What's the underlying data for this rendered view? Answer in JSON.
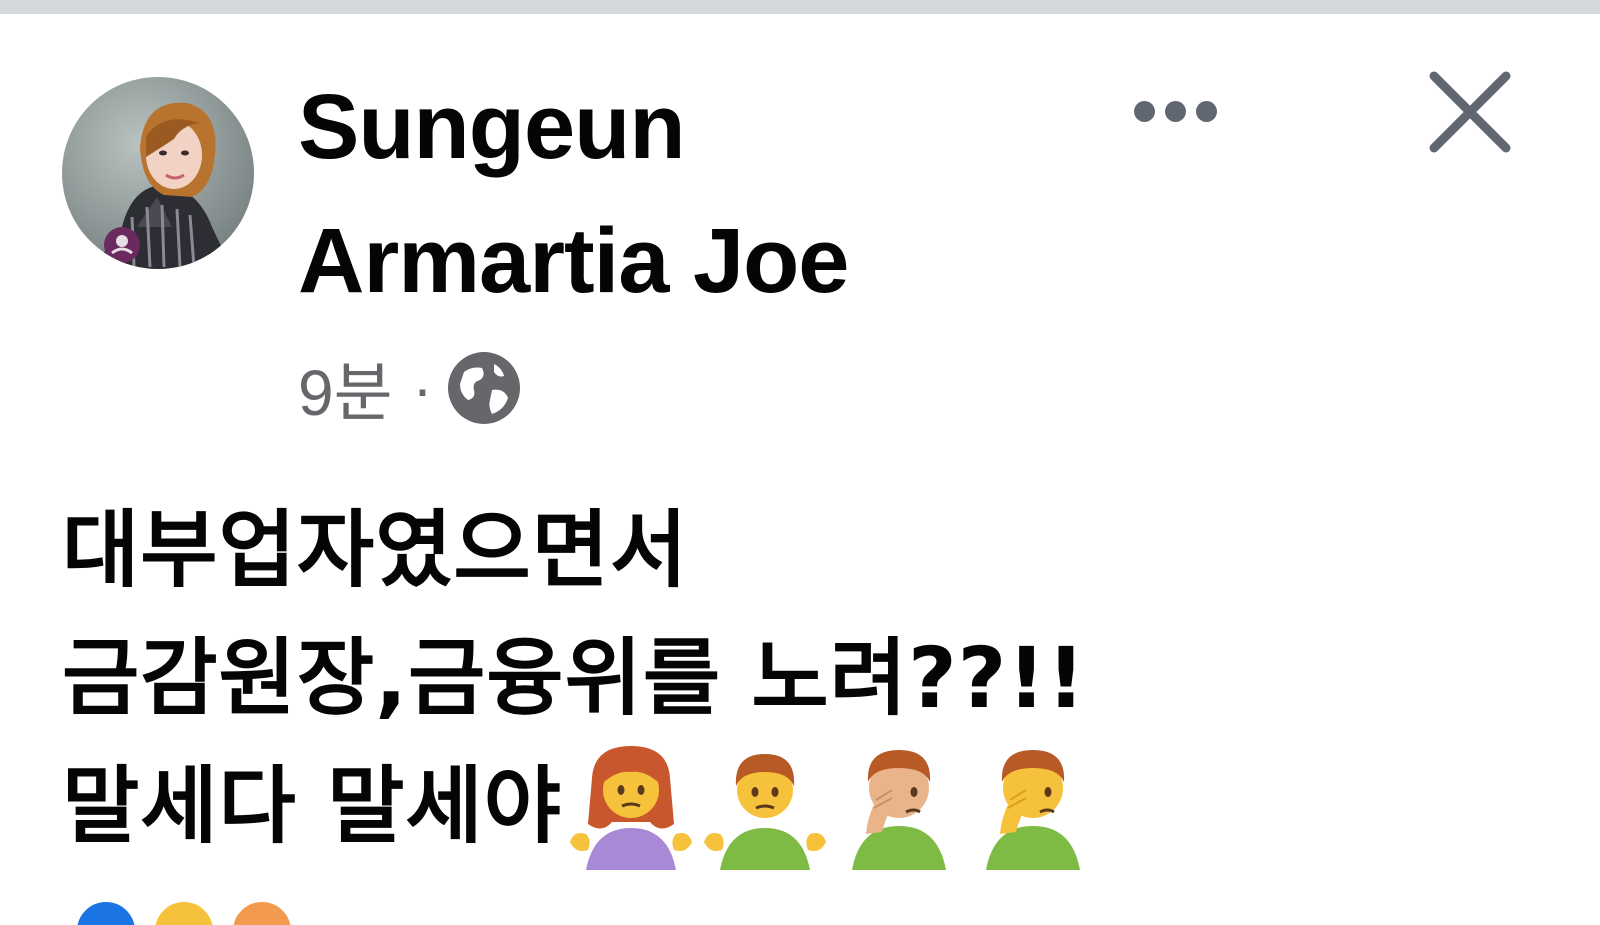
{
  "post": {
    "author_name": "Sungeun Armartia Joe",
    "time": "9분",
    "separator": "·",
    "visibility_icon": "globe-icon",
    "body_lines": [
      "대부업자였으면서",
      "금감원장,금융위를 노려??!!",
      "말세다 말세야"
    ],
    "emojis": [
      "woman-shrugging",
      "man-shrugging",
      "man-facepalming",
      "man-facepalming"
    ]
  },
  "header_actions": {
    "more_icon": "more-horizontal-icon",
    "close_icon": "close-icon"
  },
  "footer": {
    "reaction_icons": [
      "like-icon",
      "love-icon",
      "haha-icon"
    ]
  },
  "colors": {
    "text": "#050505",
    "secondary_text": "#65676b",
    "topbar": "#d4d7dc"
  }
}
